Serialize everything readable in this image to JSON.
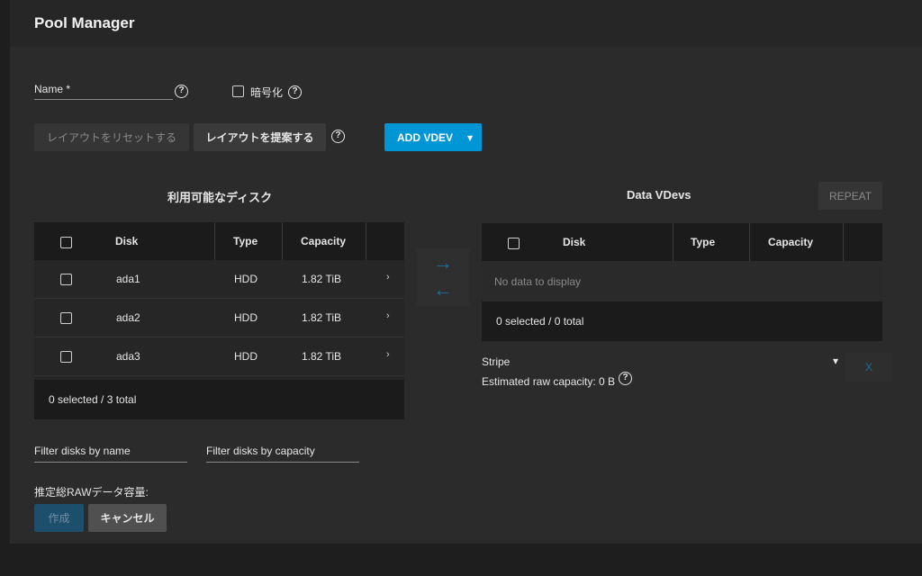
{
  "header": {
    "title": "Pool Manager"
  },
  "form": {
    "name_label": "Name *",
    "encryption_label": "暗号化",
    "help_glyph": "?"
  },
  "toolbar": {
    "reset_layout": "レイアウトをリセットする",
    "suggest_layout": "レイアウトを提案する",
    "add_vdev": "ADD VDEV",
    "dropdown_glyph": "▾"
  },
  "available": {
    "title": "利用可能なディスク",
    "columns": [
      "Disk",
      "Type",
      "Capacity"
    ],
    "rows": [
      {
        "disk": "ada1",
        "type": "HDD",
        "capacity": "1.82 TiB"
      },
      {
        "disk": "ada2",
        "type": "HDD",
        "capacity": "1.82 TiB"
      },
      {
        "disk": "ada3",
        "type": "HDD",
        "capacity": "1.82 TiB"
      }
    ],
    "footer": "0 selected / 3 total",
    "filter_name_placeholder": "Filter disks by name",
    "filter_capacity_placeholder": "Filter disks by capacity"
  },
  "transfer": {
    "right_arrow": "→",
    "left_arrow": "←"
  },
  "data_vdevs": {
    "title": "Data VDevs",
    "repeat": "REPEAT",
    "columns": [
      "Disk",
      "Type",
      "Capacity"
    ],
    "empty": "No data to display",
    "footer": "0 selected / 0 total",
    "layout_value": "Stripe",
    "remove_glyph": "X",
    "estimated_capacity": "Estimated raw capacity: 0 B"
  },
  "bottom": {
    "estimated_raw_label": "推定総RAWデータ容量:",
    "create": "作成",
    "cancel": "キャンセル"
  },
  "icons": {
    "help": "help-circle-icon",
    "chevron": "chevron-right-icon",
    "arrow_right": "arrow-right-icon",
    "arrow_left": "arrow-left-icon",
    "caret": "caret-down-icon"
  },
  "colors": {
    "primary": "#0095d5",
    "create_button": "#1d4e6b",
    "arrow": "#1b6f98"
  }
}
